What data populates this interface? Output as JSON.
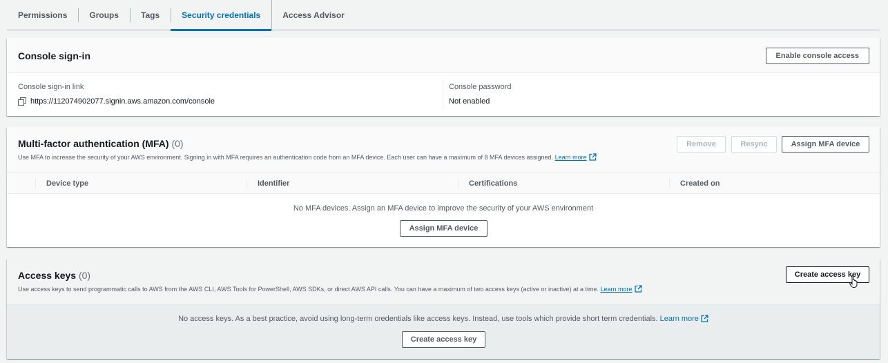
{
  "tabs": [
    {
      "label": "Permissions",
      "active": false
    },
    {
      "label": "Groups",
      "active": false
    },
    {
      "label": "Tags",
      "active": false
    },
    {
      "label": "Security credentials",
      "active": true
    },
    {
      "label": "Access Advisor",
      "active": false
    }
  ],
  "console_signin": {
    "title": "Console sign-in",
    "enable_button": "Enable console access",
    "link_label": "Console sign-in link",
    "link_value": "https://112074902077.signin.aws.amazon.com/console",
    "password_label": "Console password",
    "password_value": "Not enabled"
  },
  "mfa": {
    "title": "Multi-factor authentication (MFA)",
    "count": "(0)",
    "description": "Use MFA to increase the security of your AWS environment. Signing in with MFA requires an authentication code from an MFA device. Each user can have a maximum of 8 MFA devices assigned.",
    "learn_more": "Learn more",
    "remove_button": "Remove",
    "resync_button": "Resync",
    "assign_button": "Assign MFA device",
    "columns": [
      "Device type",
      "Identifier",
      "Certifications",
      "Created on"
    ],
    "empty_text": "No MFA devices. Assign an MFA device to improve the security of your AWS environment",
    "empty_assign_button": "Assign MFA device"
  },
  "access_keys": {
    "title": "Access keys",
    "count": "(0)",
    "description": "Use access keys to send programmatic calls to AWS from the AWS CLI, AWS Tools for PowerShell, AWS SDKs, or direct AWS API calls. You can have a maximum of two access keys (active or inactive) at a time.",
    "learn_more": "Learn more",
    "create_button": "Create access key",
    "empty_text": "No access keys. As a best practice, avoid using long-term credentials like access keys. Instead, use tools which provide short term credentials.",
    "empty_learn_more": "Learn more",
    "empty_create_button": "Create access key"
  },
  "colors": {
    "accent": "#0073bb",
    "text": "#16191f",
    "muted": "#545b64",
    "background": "#f2f3f3"
  },
  "icons": {
    "copy": "copy-icon",
    "external_link": "external-link-icon",
    "cursor": "mouse-pointer-hand-icon"
  }
}
